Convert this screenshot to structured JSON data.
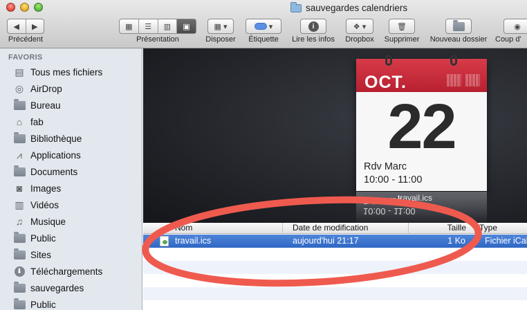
{
  "window": {
    "title": "sauvegardes calendriers"
  },
  "toolbar": {
    "back_label": "Précédent",
    "view_label": "Présentation",
    "arrange_label": "Disposer",
    "tag_label": "Étiquette",
    "info_label": "Lire les infos",
    "dropbox_label": "Dropbox",
    "delete_label": "Supprimer",
    "new_folder_label": "Nouveau dossier",
    "quicklook_label": "Coup d'"
  },
  "sidebar": {
    "header": "FAVORIS",
    "items": [
      {
        "label": "Tous mes fichiers",
        "icon": "all-files-icon"
      },
      {
        "label": "AirDrop",
        "icon": "airdrop-icon"
      },
      {
        "label": "Bureau",
        "icon": "desktop-icon"
      },
      {
        "label": "fab",
        "icon": "home-icon"
      },
      {
        "label": "Bibliothèque",
        "icon": "folder-icon"
      },
      {
        "label": "Applications",
        "icon": "applications-icon"
      },
      {
        "label": "Documents",
        "icon": "documents-icon"
      },
      {
        "label": "Images",
        "icon": "camera-icon"
      },
      {
        "label": "Vidéos",
        "icon": "film-icon"
      },
      {
        "label": "Musique",
        "icon": "music-note-icon"
      },
      {
        "label": "Public",
        "icon": "folder-icon"
      },
      {
        "label": "Sites",
        "icon": "folder-icon"
      },
      {
        "label": "Téléchargements",
        "icon": "download-icon"
      },
      {
        "label": "sauvegardes",
        "icon": "folder-icon"
      },
      {
        "label": "Public",
        "icon": "folder-icon"
      }
    ]
  },
  "preview": {
    "month": "OCT.",
    "day": "22",
    "event_title": "Rdv Marc",
    "event_time": "10:00 - 11:00",
    "reflection_filename": "travail.ics"
  },
  "list": {
    "columns": [
      "Nom",
      "Date de modification",
      "Taille",
      "Type"
    ],
    "rows": [
      {
        "name": "travail.ics",
        "modified": "aujourd'hui 21:17",
        "size": "1 Ko",
        "type": "Fichier iCal",
        "selected": true
      }
    ]
  },
  "colors": {
    "selection": "#2f67c4",
    "calendar_red": "#c62a3a",
    "annotation_red": "#ef5a4f"
  }
}
